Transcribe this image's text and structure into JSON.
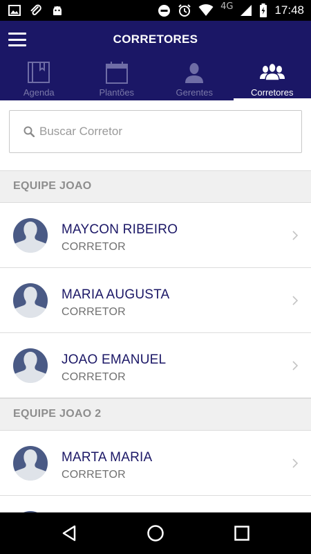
{
  "status_bar": {
    "time": "17:48",
    "network": "4G",
    "icons": [
      "image-icon",
      "paperclip-icon",
      "android-icon",
      "do-not-disturb-icon",
      "alarm-icon",
      "wifi-icon",
      "signal-icon",
      "battery-charging-icon"
    ]
  },
  "header": {
    "title": "CORRETORES",
    "menu_icon": "hamburger-menu-icon",
    "bg_color": "#1b1766"
  },
  "tabs": [
    {
      "label": "Agenda",
      "icon": "book-icon",
      "active": false
    },
    {
      "label": "Plantões",
      "icon": "calendar-icon",
      "active": false
    },
    {
      "label": "Gerentes",
      "icon": "person-icon",
      "active": false
    },
    {
      "label": "Corretores",
      "icon": "group-icon",
      "active": true
    }
  ],
  "search": {
    "placeholder": "Buscar Corretor",
    "value": ""
  },
  "sections": [
    {
      "title": "EQUIPE JOAO",
      "items": [
        {
          "name": "MAYCON RIBEIRO",
          "role": "CORRETOR"
        },
        {
          "name": "MARIA AUGUSTA",
          "role": "CORRETOR"
        },
        {
          "name": "JOAO EMANUEL",
          "role": "CORRETOR"
        }
      ]
    },
    {
      "title": "EQUIPE JOAO 2",
      "items": [
        {
          "name": "MARTA MARIA",
          "role": "CORRETOR"
        }
      ]
    }
  ],
  "navigation": {
    "icons": [
      "back-icon",
      "home-icon",
      "recents-icon"
    ]
  },
  "colors": {
    "accent": "#1b1766",
    "avatar_fill": "#4a5a85",
    "avatar_bg": "#dfe3e9"
  }
}
